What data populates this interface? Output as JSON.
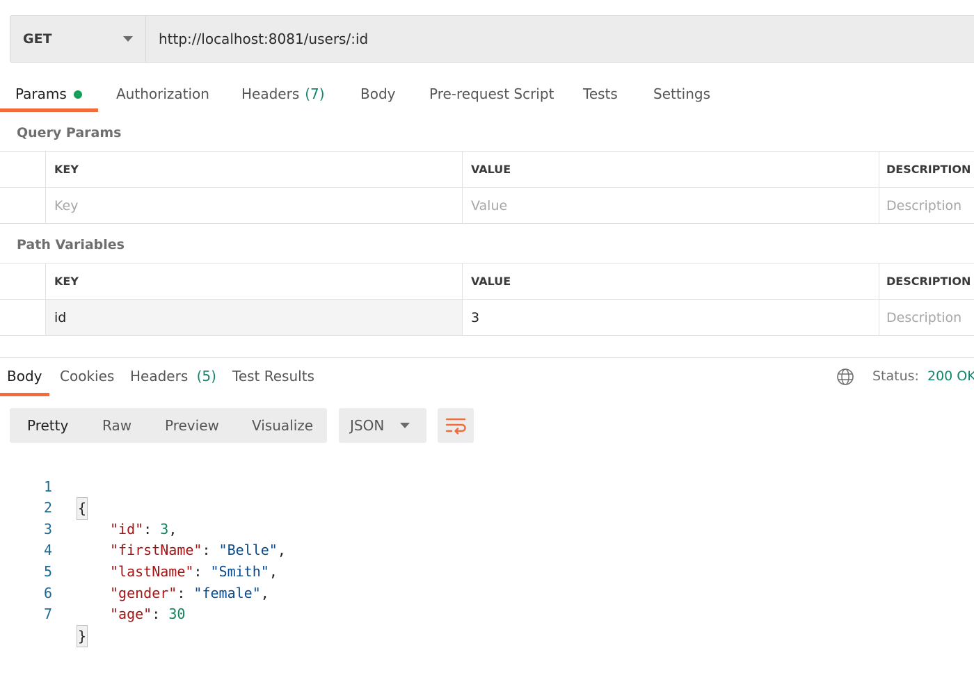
{
  "request": {
    "method": "GET",
    "url": "http://localhost:8081/users/:id"
  },
  "tabs": [
    {
      "label": "Params",
      "count": "",
      "active": true,
      "indicator": true
    },
    {
      "label": "Authorization",
      "count": ""
    },
    {
      "label": "Headers",
      "count": "(7)"
    },
    {
      "label": "Body",
      "count": ""
    },
    {
      "label": "Pre-request Script",
      "count": ""
    },
    {
      "label": "Tests",
      "count": ""
    },
    {
      "label": "Settings",
      "count": ""
    }
  ],
  "query_params": {
    "title": "Query Params",
    "columns": [
      "KEY",
      "VALUE",
      "DESCRIPTION"
    ],
    "placeholder": {
      "key": "Key",
      "value": "Value",
      "description": "Description"
    }
  },
  "path_variables": {
    "title": "Path Variables",
    "columns": [
      "KEY",
      "VALUE",
      "DESCRIPTION"
    ],
    "rows": [
      {
        "key": "id",
        "value": "3",
        "description_placeholder": "Description"
      }
    ]
  },
  "response": {
    "tabs": [
      {
        "label": "Body",
        "count": "",
        "active": true
      },
      {
        "label": "Cookies",
        "count": ""
      },
      {
        "label": "Headers",
        "count": "(5)"
      },
      {
        "label": "Test Results",
        "count": ""
      }
    ],
    "status_label": "Status:",
    "status_value": "200 OK",
    "formats": [
      "Pretty",
      "Raw",
      "Preview",
      "Visualize"
    ],
    "active_format": "Pretty",
    "language": "JSON",
    "code_lines": [
      {
        "no": "1",
        "text": "{"
      },
      {
        "no": "2",
        "key": "\"id\"",
        "value": "3",
        "type": "number",
        "comma": ","
      },
      {
        "no": "3",
        "key": "\"firstName\"",
        "value": "\"Belle\"",
        "type": "string",
        "comma": ","
      },
      {
        "no": "4",
        "key": "\"lastName\"",
        "value": "\"Smith\"",
        "type": "string",
        "comma": ","
      },
      {
        "no": "5",
        "key": "\"gender\"",
        "value": "\"female\"",
        "type": "string",
        "comma": ","
      },
      {
        "no": "6",
        "key": "\"age\"",
        "value": "30",
        "type": "number",
        "comma": ""
      },
      {
        "no": "7",
        "text": "}"
      }
    ]
  },
  "colors": {
    "accent": "#f26b3a",
    "success": "#14866d",
    "indicator": "#14a05a"
  }
}
